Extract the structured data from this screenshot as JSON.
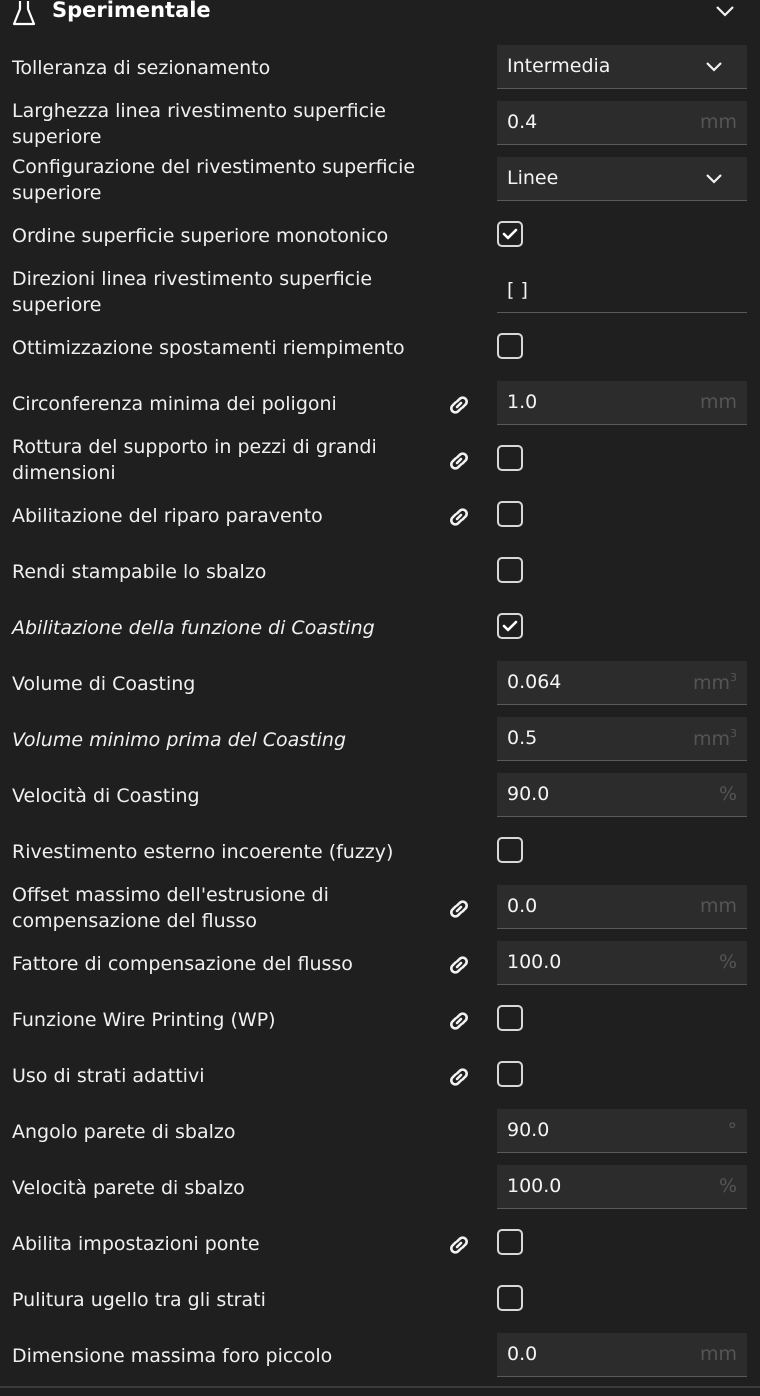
{
  "section": {
    "title": "Sperimentale",
    "icon": "flask-icon"
  },
  "rows": [
    {
      "label": "Tolleranza di sezionamento",
      "type": "select",
      "value": "Intermedia",
      "link": false
    },
    {
      "label": "Larghezza linea rivestimento superficie superiore",
      "type": "number",
      "value": "0.4",
      "unit": "mm",
      "link": false
    },
    {
      "label": "Configurazione del rivestimento superficie superiore",
      "type": "select",
      "value": "Linee",
      "link": false
    },
    {
      "label": "Ordine superficie superiore monotonico",
      "type": "checkbox",
      "checked": true,
      "link": false
    },
    {
      "label": "Direzioni linea rivestimento superficie superiore",
      "type": "text",
      "value": "[ ]",
      "link": false
    },
    {
      "label": "Ottimizzazione spostamenti riempimento",
      "type": "checkbox",
      "checked": false,
      "link": false
    },
    {
      "label": "Circonferenza minima dei poligoni",
      "type": "number",
      "value": "1.0",
      "unit": "mm",
      "link": true
    },
    {
      "label": "Rottura del supporto in pezzi di grandi dimensioni",
      "type": "checkbox",
      "checked": false,
      "link": true
    },
    {
      "label": "Abilitazione del riparo paravento",
      "type": "checkbox",
      "checked": false,
      "link": true
    },
    {
      "label": "Rendi stampabile lo sbalzo",
      "type": "checkbox",
      "checked": false,
      "link": false
    },
    {
      "label": "Abilitazione della funzione di Coasting",
      "type": "checkbox",
      "checked": true,
      "link": false,
      "italic": true
    },
    {
      "label": "Volume di Coasting",
      "type": "number",
      "value": "0.064",
      "unit": "mm",
      "unit_sup": "3",
      "link": false
    },
    {
      "label": "Volume minimo prima del Coasting",
      "type": "number",
      "value": "0.5",
      "unit": "mm",
      "unit_sup": "3",
      "link": false,
      "italic": true
    },
    {
      "label": "Velocità di Coasting",
      "type": "number",
      "value": "90.0",
      "unit": "%",
      "link": false
    },
    {
      "label": "Rivestimento esterno incoerente (fuzzy)",
      "type": "checkbox",
      "checked": false,
      "link": false
    },
    {
      "label": "Offset massimo dell'estrusione di compensazione del flusso",
      "type": "number",
      "value": "0.0",
      "unit": "mm",
      "link": true
    },
    {
      "label": "Fattore di compensazione del flusso",
      "type": "number",
      "value": "100.0",
      "unit": "%",
      "link": true
    },
    {
      "label": "Funzione Wire Printing (WP)",
      "type": "checkbox",
      "checked": false,
      "link": true
    },
    {
      "label": "Uso di strati adattivi",
      "type": "checkbox",
      "checked": false,
      "link": true
    },
    {
      "label": "Angolo parete di sbalzo",
      "type": "number",
      "value": "90.0",
      "unit": "°",
      "link": false
    },
    {
      "label": "Velocità parete di sbalzo",
      "type": "number",
      "value": "100.0",
      "unit": "%",
      "link": false
    },
    {
      "label": "Abilita impostazioni ponte",
      "type": "checkbox",
      "checked": false,
      "link": true
    },
    {
      "label": "Pulitura ugello tra gli strati",
      "type": "checkbox",
      "checked": false,
      "link": false
    },
    {
      "label": "Dimensione massima foro piccolo",
      "type": "number",
      "value": "0.0",
      "unit": "mm",
      "link": false
    }
  ]
}
